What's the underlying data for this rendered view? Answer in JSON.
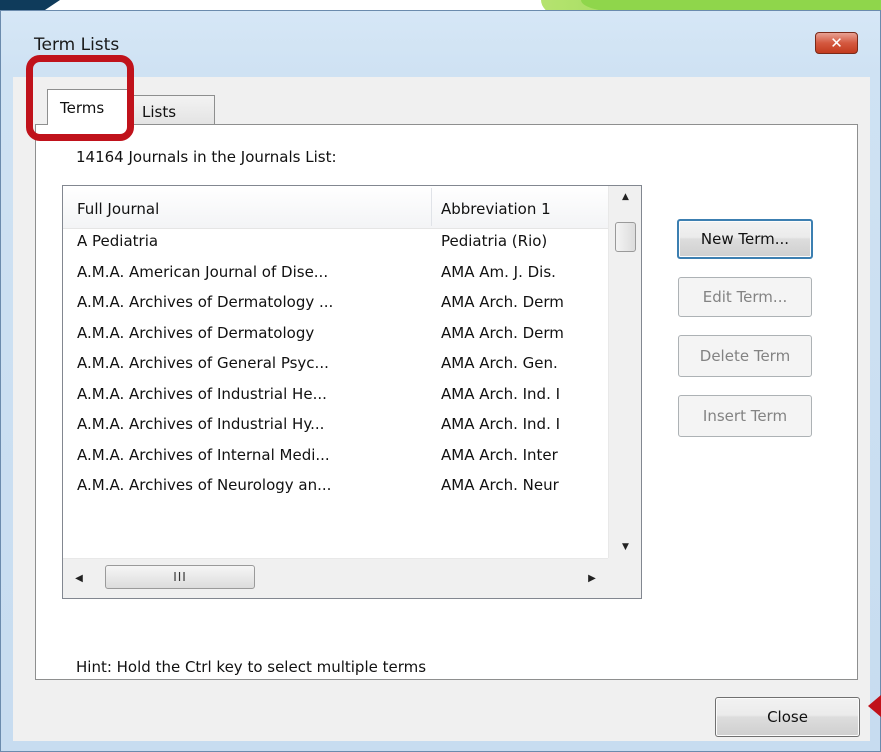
{
  "window": {
    "title": "Term Lists",
    "close_glyph": "✕"
  },
  "tabs": [
    {
      "label": "Terms",
      "selected": true
    },
    {
      "label": "Lists",
      "selected": false
    }
  ],
  "list": {
    "caption": "14164 Journals in the Journals List:",
    "columns": [
      "Full Journal",
      "Abbreviation 1"
    ],
    "rows": [
      {
        "full": "A Pediatria",
        "abbr": "Pediatria (Rio)"
      },
      {
        "full": "A.M.A. American Journal of Dise...",
        "abbr": "AMA Am. J. Dis."
      },
      {
        "full": "A.M.A. Archives of Dermatology ...",
        "abbr": "AMA Arch. Derm"
      },
      {
        "full": "A.M.A. Archives of Dermatology",
        "abbr": "AMA Arch. Derm"
      },
      {
        "full": "A.M.A. Archives of General Psyc...",
        "abbr": "AMA Arch. Gen."
      },
      {
        "full": "A.M.A. Archives of Industrial He...",
        "abbr": "AMA Arch. Ind. I"
      },
      {
        "full": "A.M.A. Archives of Industrial Hy...",
        "abbr": "AMA Arch. Ind. I"
      },
      {
        "full": "A.M.A. Archives of Internal Medi...",
        "abbr": "AMA Arch. Inter"
      },
      {
        "full": "A.M.A. Archives of Neurology an...",
        "abbr": "AMA Arch. Neur"
      }
    ],
    "scroll_glyphs": {
      "up": "▲",
      "down": "▼",
      "left": "◀",
      "right": "▶",
      "grip": "III"
    }
  },
  "buttons": {
    "new_term": {
      "label": "New Term...",
      "enabled": true
    },
    "edit_term": {
      "label": "Edit Term...",
      "enabled": false
    },
    "delete_term": {
      "label": "Delete Term",
      "enabled": false
    },
    "insert_term": {
      "label": "Insert Term",
      "enabled": false
    },
    "close": {
      "label": "Close",
      "enabled": true
    }
  },
  "hint": "Hint: Hold the Ctrl key to select multiple terms",
  "colors": {
    "highlight": "#c0121b",
    "dialog_frame": "#cfe2f3",
    "close_button": "#d4583f"
  }
}
